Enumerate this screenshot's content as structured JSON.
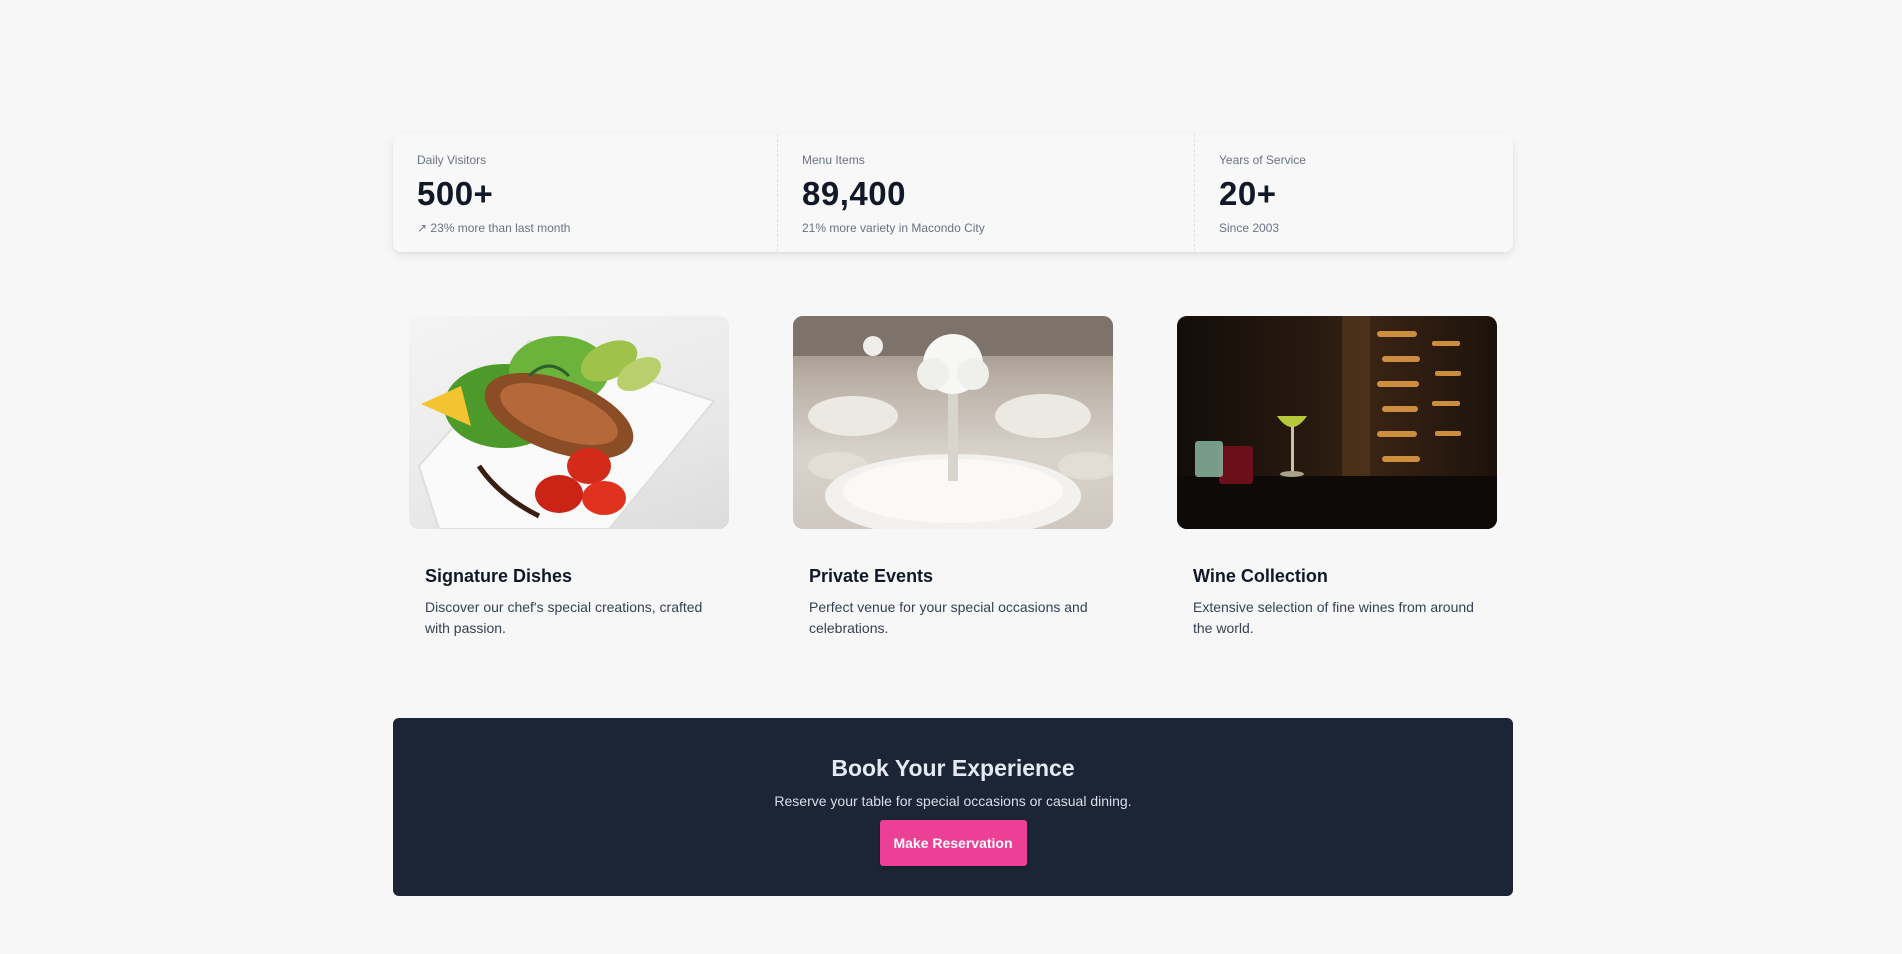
{
  "stats": [
    {
      "title": "Daily Visitors",
      "value": "500+",
      "desc": "↗ 23% more than last month"
    },
    {
      "title": "Menu Items",
      "value": "89,400",
      "desc": "21% more variety in Macondo City"
    },
    {
      "title": "Years of Service",
      "value": "20+",
      "desc": "Since 2003"
    }
  ],
  "features": [
    {
      "title": "Signature Dishes",
      "text": "Discover our chef's special creations, crafted with passion."
    },
    {
      "title": "Private Events",
      "text": "Perfect venue for your special occasions and celebrations."
    },
    {
      "title": "Wine Collection",
      "text": "Extensive selection of fine wines from around the world."
    }
  ],
  "cta": {
    "title": "Book Your Experience",
    "text": "Reserve your table for special occasions or casual dining.",
    "button_label": "Make Reservation"
  },
  "colors": {
    "background": "#f7f7f8",
    "cta_background": "#1c2536",
    "accent": "#ec3f96"
  }
}
